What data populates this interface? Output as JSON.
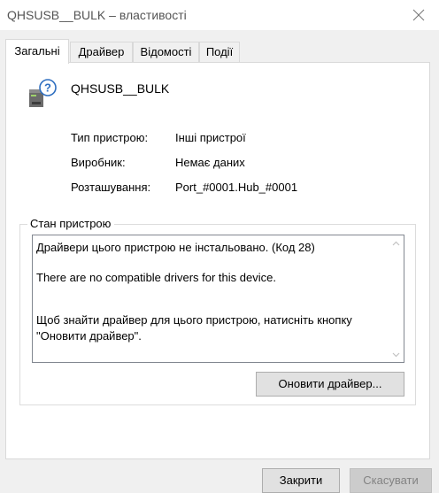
{
  "window": {
    "title": "QHSUSB__BULK – властивості"
  },
  "tabs": [
    {
      "label": "Загальні",
      "active": true
    },
    {
      "label": "Драйвер",
      "active": false
    },
    {
      "label": "Відомості",
      "active": false
    },
    {
      "label": "Події",
      "active": false
    }
  ],
  "device": {
    "name": "QHSUSB__BULK",
    "icon": "unknown-device-icon"
  },
  "properties": [
    {
      "label": "Тип пристрою:",
      "value": "Інші пристрої"
    },
    {
      "label": "Виробник:",
      "value": "Немає даних"
    },
    {
      "label": "Розташування:",
      "value": "Port_#0001.Hub_#0001"
    }
  ],
  "status": {
    "legend": "Стан пристрою",
    "lines": [
      "Драйвери цього пристрою не інстальовано. (Код 28)",
      "There are no compatible drivers for this device.",
      "Щоб знайти драйвер для цього пристрою, натисніть кнопку",
      "\"Оновити драйвер\"."
    ]
  },
  "buttons": {
    "update_driver": "Оновити драйвер...",
    "close": "Закрити",
    "cancel": "Скасувати"
  },
  "colors": {
    "panel_background": "#ffffff",
    "window_background": "#f0f0f0",
    "disabled_text": "#838383"
  }
}
